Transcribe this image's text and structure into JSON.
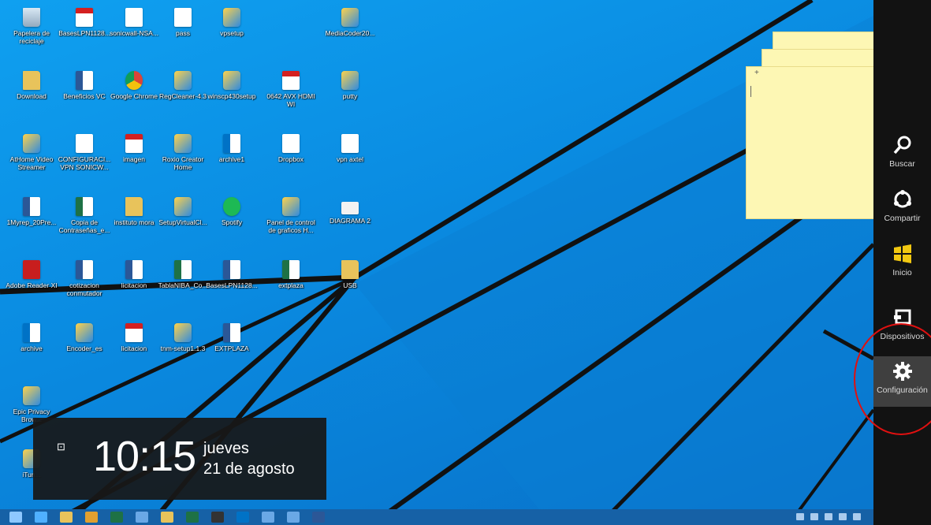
{
  "desktop_icons": [
    {
      "label": "Papelera de reciclaje",
      "type": "recycle",
      "icon": "recycle-bin-icon"
    },
    {
      "label": "BasesLPN1128...",
      "type": "pdf",
      "icon": "pdf-icon"
    },
    {
      "label": "sonicwall-NSA...",
      "type": "doc",
      "icon": "file-icon"
    },
    {
      "label": "pass",
      "type": "doc",
      "icon": "file-icon"
    },
    {
      "label": "vpsetup",
      "type": "app",
      "icon": "setup-icon"
    },
    {
      "label": "MediaCoder20...",
      "type": "app",
      "icon": "mediacoder-icon"
    },
    {
      "label": "Download",
      "type": "folder",
      "icon": "folder-icon"
    },
    {
      "label": "Beneficios VC",
      "type": "word",
      "icon": "word-icon"
    },
    {
      "label": "Google Chrome",
      "type": "chrome",
      "icon": "chrome-icon"
    },
    {
      "label": "RegCleaner-4.3",
      "type": "app",
      "icon": "regcleaner-icon"
    },
    {
      "label": "winscp430setup",
      "type": "app",
      "icon": "winscp-icon"
    },
    {
      "label": "0642 AVX HDMI WI",
      "type": "pdf",
      "icon": "pdf-icon"
    },
    {
      "label": "putty",
      "type": "app",
      "icon": "putty-icon"
    },
    {
      "label": "AtHome Video Streamer",
      "type": "app",
      "icon": "athome-icon"
    },
    {
      "label": "CONFIGURACI... VPN SONICW...",
      "type": "doc",
      "icon": "file-icon"
    },
    {
      "label": "imagen",
      "type": "pdf",
      "icon": "pdf-icon"
    },
    {
      "label": "Roxio Creator Home",
      "type": "app",
      "icon": "roxio-icon"
    },
    {
      "label": "archive1",
      "type": "outlook",
      "icon": "outlook-file-icon"
    },
    {
      "label": "Dropbox",
      "type": "dropbox",
      "icon": "dropbox-icon"
    },
    {
      "label": "vpn axtel",
      "type": "doc",
      "icon": "file-icon"
    },
    {
      "label": "1Myrep_20Pre...",
      "type": "word",
      "icon": "word-icon"
    },
    {
      "label": "Copia de Contraseñas_e...",
      "type": "excel",
      "icon": "excel-icon"
    },
    {
      "label": "instituto mora",
      "type": "folder",
      "icon": "folder-icon"
    },
    {
      "label": "SetupVirtualCl...",
      "type": "app",
      "icon": "setup-icon"
    },
    {
      "label": "Spotify",
      "type": "spotify",
      "icon": "spotify-icon"
    },
    {
      "label": "Panel de control de graficos H...",
      "type": "app",
      "icon": "graphics-panel-icon"
    },
    {
      "label": "DIAGRAMA 2",
      "type": "mail",
      "icon": "email-file-icon"
    },
    {
      "label": "Adobe Reader XI",
      "type": "acrobat",
      "icon": "adobe-reader-icon"
    },
    {
      "label": "cotizacion conmutador",
      "type": "word",
      "icon": "word-icon"
    },
    {
      "label": "licitacion",
      "type": "word",
      "icon": "word-icon"
    },
    {
      "label": "TablaNIBA_Co...",
      "type": "excel",
      "icon": "excel-icon"
    },
    {
      "label": "BasesLPN1128...",
      "type": "word",
      "icon": "word-icon"
    },
    {
      "label": "extplaza",
      "type": "excel",
      "icon": "excel-icon"
    },
    {
      "label": "USB",
      "type": "folder",
      "icon": "folder-icon"
    },
    {
      "label": "archive",
      "type": "outlook",
      "icon": "outlook-file-icon"
    },
    {
      "label": "Encoder_es",
      "type": "app",
      "icon": "encoder-icon"
    },
    {
      "label": "licitacion",
      "type": "pdf",
      "icon": "pdf-icon"
    },
    {
      "label": "tnm-setup1.1.3",
      "type": "app",
      "icon": "setup-icon"
    },
    {
      "label": "EXTPLAZA",
      "type": "word",
      "icon": "word-icon"
    },
    {
      "label": "Epic Privacy Brow...",
      "type": "app",
      "icon": "epic-browser-icon"
    },
    {
      "label": "iTun...",
      "type": "app",
      "icon": "itunes-icon"
    }
  ],
  "sticky_note": {
    "plus": "+"
  },
  "lock_clock": {
    "network_icon": "network-icon",
    "time": "10:15",
    "day": "jueves",
    "date": "21 de agosto"
  },
  "taskbar": {
    "apps": [
      "start-icon",
      "ie-icon",
      "explorer-icon",
      "chrome-icon",
      "excel-icon",
      "app-icon",
      "folder-icon",
      "excel-icon",
      "terminal-icon",
      "outlook-icon",
      "app-icon",
      "app-icon",
      "word-icon"
    ],
    "tray": [
      "keyboard-icon",
      "chevron-icon",
      "flag-icon",
      "app-icon",
      "network-icon"
    ]
  },
  "charms": [
    {
      "label": "Buscar",
      "icon": "search-icon"
    },
    {
      "label": "Compartir",
      "icon": "share-icon"
    },
    {
      "label": "Inicio",
      "icon": "windows-start-icon"
    },
    {
      "label": "Dispositivos",
      "icon": "devices-icon"
    },
    {
      "label": "Configuración",
      "icon": "gear-icon",
      "active": true
    }
  ],
  "colors": {
    "accent": "#1661a6",
    "charm_bg": "#121212",
    "highlight_ring": "#e01010",
    "sticky": "#fdf7b4"
  }
}
